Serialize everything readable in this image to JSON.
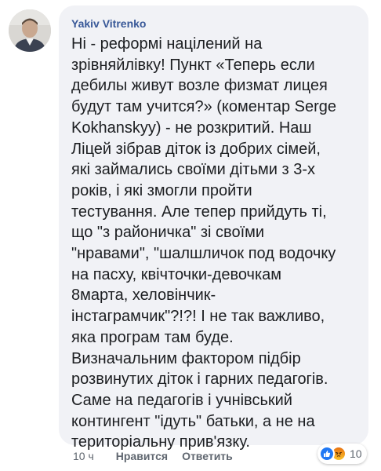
{
  "comment": {
    "author": "Yakiv Vitrenko",
    "text": "Ні - реформі націлений на\nзрівняйлівку! Пункт «Теперь если\nдебилы живут возле физмат лицея\nбудут там учится?» (коментар Serge\nKokhanskyy) - не розкритий. Наш\nЛіцей зібрав діток із добрих сімей,\nякі займались своїми дітьми з 3-х\nроків, і які змогли пройти\nтестування. Але тепер прийдуть ті,\nщо  \"з районичка\" зі своїми\n\"нравами\", \"шалшличок под водочку\nна пасху, квічточки-девочкам\n8марта, хеловінчик-\nінстаграмчик\"?!?!  І не так важливо,\nяка програм там буде.\nВизначальним фактором підбір\nрозвинутих діток і гарних педагогів.\nСаме на педагогів і учнівський\nконтингент  \"ідуть\" батьки, а не на\nтериторіальну прив'язку."
  },
  "meta": {
    "time": "10 ч",
    "like_label": "Нравится",
    "reply_label": "Ответить"
  },
  "reactions": {
    "count": "10",
    "icons": [
      "like-icon",
      "angry-icon"
    ],
    "colors": {
      "like": "#2078f4",
      "angry_top": "#e9710f",
      "angry_bottom": "#f8c12c"
    }
  },
  "colors": {
    "author": "#385898",
    "text": "#1c1e21",
    "bubble": "#f1f2f6",
    "meta": "#606770"
  }
}
